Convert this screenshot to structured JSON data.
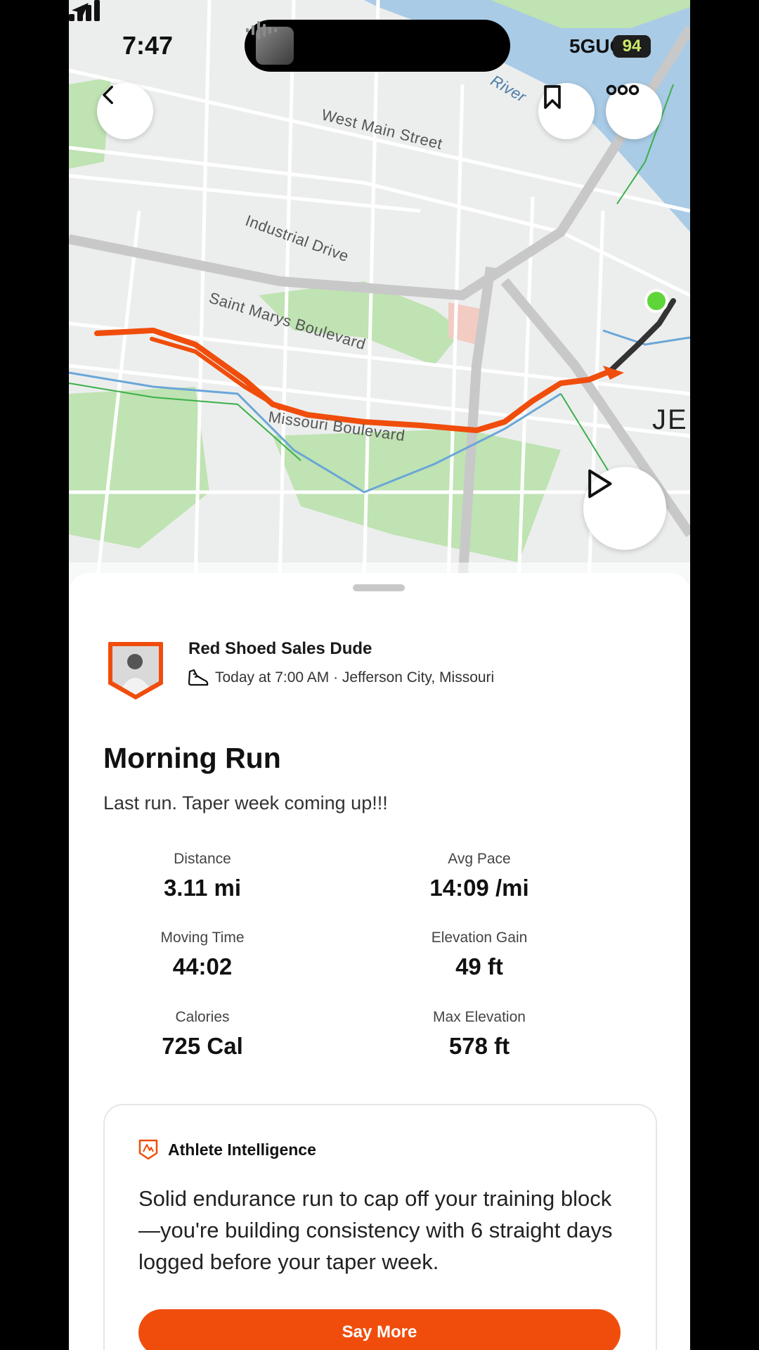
{
  "status_bar": {
    "time": "7:47",
    "network": "5GUC",
    "battery": "94"
  },
  "map": {
    "labels": {
      "west_main": "West Main Street",
      "industrial": "Industrial Drive",
      "saint_marys": "Saint Marys Boulevard",
      "missouri": "Missouri Boulevard",
      "river": "River",
      "city_partial": "JE"
    },
    "colors": {
      "route": "#f04d0c",
      "route_end": "#333333",
      "start_marker": "#5ed63a",
      "water": "#a9cbe6",
      "park": "#bfe3b2"
    }
  },
  "activity": {
    "athlete_name": "Red Shoed Sales Dude",
    "meta": "Today at 7:00 AM · Jefferson City, Missouri",
    "title": "Morning Run",
    "description": "Last run. Taper week coming up!!!",
    "stats": [
      {
        "label": "Distance",
        "value": "3.11 mi"
      },
      {
        "label": "Avg Pace",
        "value": "14:09 /mi"
      },
      {
        "label": "Moving Time",
        "value": "44:02"
      },
      {
        "label": "Elevation Gain",
        "value": "49 ft"
      },
      {
        "label": "Calories",
        "value": "725 Cal"
      },
      {
        "label": "Max Elevation",
        "value": "578 ft"
      }
    ]
  },
  "athlete_intelligence": {
    "title": "Athlete Intelligence",
    "text": "Solid endurance run to cap off your training block—you're building consistency with 6 straight days logged before your taper week.",
    "button": "Say More"
  },
  "icons": {
    "back": "chevron-left-icon",
    "bookmark": "bookmark-icon",
    "more": "more-icon",
    "play": "play-icon",
    "location": "location-arrow-icon",
    "shoe": "shoe-icon",
    "ai": "athlete-intelligence-icon"
  }
}
